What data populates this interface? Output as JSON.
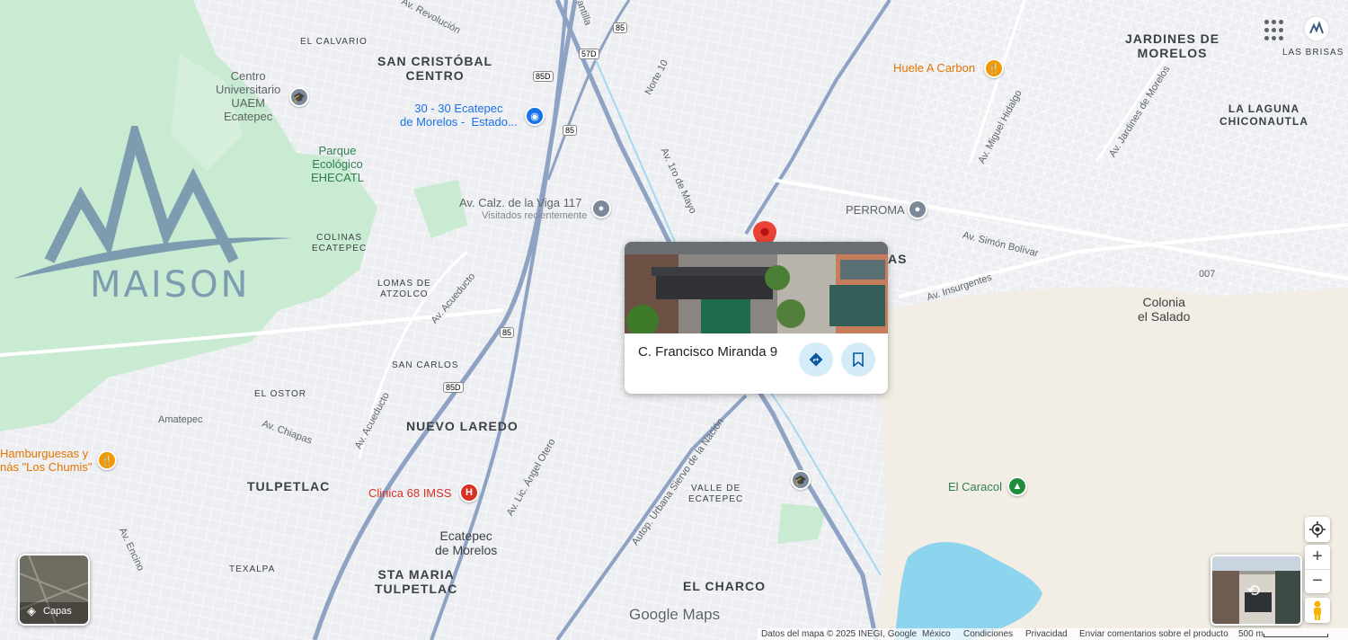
{
  "map": {
    "places": {
      "el_calvario": "EL CALVARIO",
      "san_cristobal": "SAN CRISTÓBAL\nCENTRO",
      "jardines": "JARDINES DE\nMORELOS",
      "las_brisas": "LAS BRISAS",
      "la_laguna": "LA LAGUNA\nCHICONAUTLA",
      "colinas": "COLINAS\nECATEPEC",
      "lomas": "LOMAS DE\nATZOLCO",
      "san_carlos": "SAN CARLOS",
      "el_ostor": "EL OSTOR",
      "amatepec": "Amatepec",
      "nuevo_laredo": "NUEVO LAREDO",
      "tulpetlac": "TULPETLAC",
      "valle": "VALLE DE\nECATEPEC",
      "ecatepec": "Ecatepec\nde Morelos",
      "sta_maria": "STA MARIA\nTULPETLAC",
      "texalpa": "TEXALPA",
      "el_charco": "EL CHARCO",
      "colonia_salado": "Colonia\nel Salado",
      "las_partial": "AS",
      "num_007": "007"
    },
    "streets": {
      "revolucion": "Av. Revolución",
      "norte10": "Norte 10",
      "ave_1ro_mayo": "Av. 1ro de Mayo",
      "miguel_hidalgo": "Av. Miguel Hidalgo",
      "jardines_morelos": "Av. Jardines de Morelos",
      "simon_bolivar": "Av. Simón Bolívar",
      "insurgentes": "Av. Insurgentes",
      "acueducto1": "Av. Acueducto",
      "acueducto2": "Av. Acueducto",
      "chiapas": "Av. Chiapas",
      "angel_otero": "Av. Lic. Ángel Otero",
      "siervo_nacion": "Autop. Urbana Siervo de la Nación",
      "encino": "Av. Encino",
      "r85a": "85",
      "r85b": "85",
      "r85c": "85",
      "r85d": "85D",
      "r85e": "85D",
      "r57d": "57D",
      "santa_partial": "antilla"
    },
    "pois": {
      "uaem": "Centro\nUniversitario\nUAEM\nEcatepec",
      "estadio": "30 - 30 Ecatepec\nde Morelos -  Estado...",
      "parque": "Parque\nEcológico\nEHECATL",
      "viga": "Av. Calz. de la Viga 117",
      "viga_sub": "Visitados recientemente",
      "perroma": "PERROMA",
      "huele": "Huele A Carbon",
      "hamburguesas": "Hamburguesas y\nnás \"Los Chumis\"",
      "clinica": "Clinica 68 IMSS",
      "caracol": "El Caracol"
    }
  },
  "watermark": {
    "brand": "MAISON"
  },
  "place_card": {
    "title": "C. Francisco Miranda 9",
    "directions_icon": "directions-icon",
    "save_icon": "bookmark-icon"
  },
  "controls": {
    "layers_label": "Capas",
    "zoom_in": "+",
    "zoom_out": "−",
    "google_logo": "Google Maps"
  },
  "footer": {
    "data": "Datos del mapa © 2025 INEGI, Google",
    "country": "México",
    "terms": "Condiciones",
    "privacy": "Privacidad",
    "feedback": "Enviar comentarios sobre el producto",
    "scale": "500 m"
  },
  "colors": {
    "highway": "#8ea2c4",
    "park": "#c9ecd3",
    "water": "#8bd3ef",
    "sand": "#f1ede4",
    "road": "#ffffff",
    "accent_blue": "#1a73e8"
  }
}
